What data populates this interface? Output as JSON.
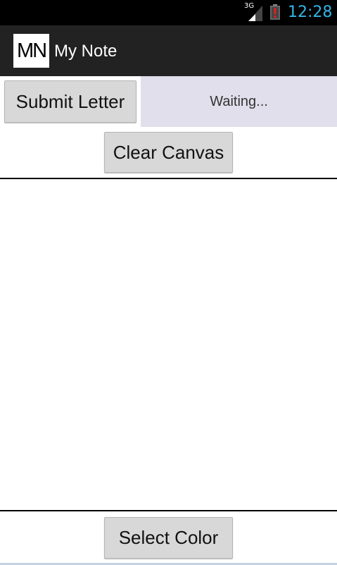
{
  "status_bar": {
    "network": "3G",
    "time": "12:28",
    "icons": [
      "signal-icon",
      "battery-alert-icon"
    ],
    "clock_color": "#33b5e5"
  },
  "action_bar": {
    "icon_text": "MN",
    "title": "My Note"
  },
  "controls": {
    "submit_label": "Submit Letter",
    "status_text": "Waiting...",
    "clear_label": "Clear Canvas",
    "select_color_label": "Select Color"
  },
  "colors": {
    "action_bar": "#222222",
    "status_box": "#e0dfeb",
    "button": "#d8d8d8"
  }
}
